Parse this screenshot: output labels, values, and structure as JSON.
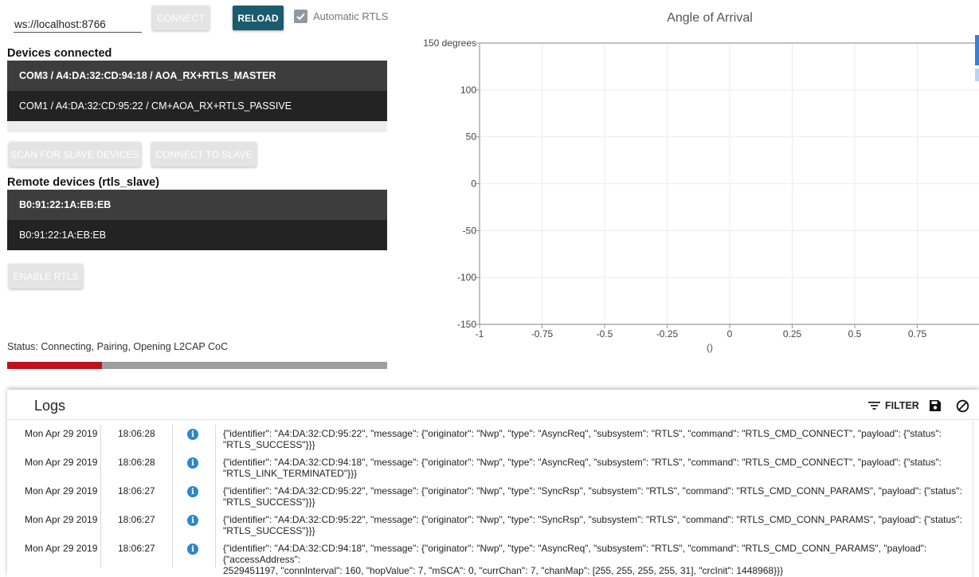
{
  "connection": {
    "url": "ws://localhost:8766",
    "connect_label": "CONNECT",
    "reload_label": "RELOAD",
    "auto_rtls_label": "Automatic RTLS",
    "auto_rtls_checked": true
  },
  "devices": {
    "title": "Devices connected",
    "items": [
      "COM3 / A4:DA:32:CD:94:18 / AOA_RX+RTLS_MASTER",
      "COM1 / A4:DA:32:CD:95:22 / CM+AOA_RX+RTLS_PASSIVE"
    ]
  },
  "actions": {
    "scan_label": "SCAN FOR SLAVE DEVICES",
    "connect_slave_label": "CONNECT TO SLAVE",
    "enable_label": "ENABLE RTLS"
  },
  "remote": {
    "title": "Remote devices (rtls_slave)",
    "items": [
      "B0:91:22:1A:EB:EB",
      "B0:91:22:1A:EB:EB"
    ]
  },
  "status": {
    "text": "Status: Connecting, Pairing, Opening L2CAP CoC",
    "progress": 0.25
  },
  "chart_data": {
    "type": "line",
    "title": "Angle of Arrival",
    "xlabel": "()",
    "ylabel": "",
    "xlim": [
      -1,
      1
    ],
    "ylim": [
      -150,
      150
    ],
    "x_ticks": [
      "-1",
      "-0.75",
      "-0.5",
      "-0.25",
      "0",
      "0.25",
      "0.5",
      "0.75"
    ],
    "y_ticks": [
      "150 degrees",
      "100",
      "50",
      "0",
      "-50",
      "-100",
      "-150"
    ],
    "grid": true,
    "series": []
  },
  "logs": {
    "title": "Logs",
    "filter_label": "FILTER",
    "save_icon": "save-icon",
    "clear_icon": "clear-icon",
    "rows": [
      {
        "date": "Mon Apr 29 2019",
        "time": "18:06:28",
        "msg_line1": "{\"identifier\": \"A4:DA:32:CD:95:22\", \"message\": {\"originator\": \"Nwp\", \"type\": \"AsyncReq\", \"subsystem\": \"RTLS\", \"command\": \"RTLS_CMD_CONNECT\", \"payload\": {\"status\":",
        "msg_line2": "\"RTLS_SUCCESS\"}}}"
      },
      {
        "date": "Mon Apr 29 2019",
        "time": "18:06:28",
        "msg_line1": "{\"identifier\": \"A4:DA:32:CD:94:18\", \"message\": {\"originator\": \"Nwp\", \"type\": \"AsyncReq\", \"subsystem\": \"RTLS\", \"command\": \"RTLS_CMD_CONNECT\", \"payload\": {\"status\":",
        "msg_line2": "\"RTLS_LINK_TERMINATED\"}}}"
      },
      {
        "date": "Mon Apr 29 2019",
        "time": "18:06:27",
        "msg_line1": "{\"identifier\": \"A4:DA:32:CD:95:22\", \"message\": {\"originator\": \"Nwp\", \"type\": \"SyncRsp\", \"subsystem\": \"RTLS\", \"command\": \"RTLS_CMD_CONN_PARAMS\", \"payload\": {\"status\":",
        "msg_line2": "\"RTLS_SUCCESS\"}}}"
      },
      {
        "date": "Mon Apr 29 2019",
        "time": "18:06:27",
        "msg_line1": "{\"identifier\": \"A4:DA:32:CD:95:22\", \"message\": {\"originator\": \"Nwp\", \"type\": \"SyncRsp\", \"subsystem\": \"RTLS\", \"command\": \"RTLS_CMD_CONN_PARAMS\", \"payload\": {\"status\":",
        "msg_line2": "\"RTLS_SUCCESS\"}}}"
      },
      {
        "date": "Mon Apr 29 2019",
        "time": "18:06:27",
        "msg_line1": "{\"identifier\": \"A4:DA:32:CD:94:18\", \"message\": {\"originator\": \"Nwp\", \"type\": \"AsyncReq\", \"subsystem\": \"RTLS\", \"command\": \"RTLS_CMD_CONN_PARAMS\", \"payload\": {\"accessAddress\":",
        "msg_line2": "2529451197, \"connInterval\": 160, \"hopValue\": 7, \"mSCA\": 0, \"currChan\": 7, \"chanMap\": [255, 255, 255, 255, 31], \"crcInit\": 1448968}}}"
      }
    ]
  },
  "colors": {
    "primary_button": "#1a5b6e",
    "progress_fill": "#c0121b",
    "info_icon": "#2c86c9"
  }
}
